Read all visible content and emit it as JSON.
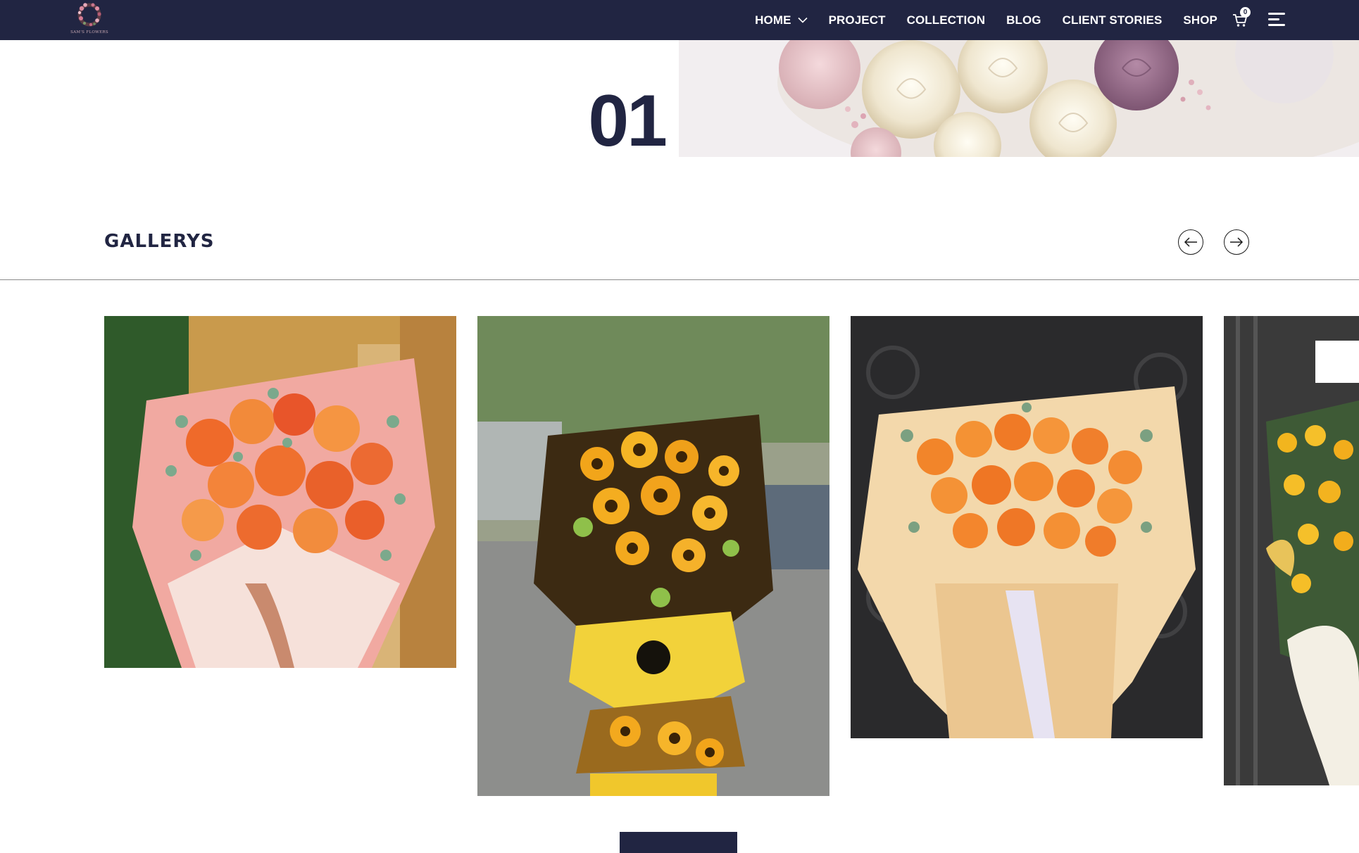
{
  "brand": {
    "logo_text": "SAM'S FLOWERS"
  },
  "nav": {
    "items": [
      {
        "label": "HOME"
      },
      {
        "label": "PROJECT"
      },
      {
        "label": "COLLECTION"
      },
      {
        "label": "BLOG"
      },
      {
        "label": "CLIENT STORIES"
      },
      {
        "label": "SHOP"
      }
    ],
    "cart_count": "0"
  },
  "hero": {
    "slide_number": "01"
  },
  "gallery": {
    "title": "GALLERYS",
    "items": [
      {
        "name": "orange roses bouquet with eucalyptus in pink wrapping"
      },
      {
        "name": "sunflower congratulation flower stand"
      },
      {
        "name": "orange roses bouquet in cream wrapping"
      },
      {
        "name": "yellow flower stand with white ribbon"
      }
    ]
  },
  "colors": {
    "navbar": "#212542",
    "accent": "#212542",
    "text": "#212542",
    "background": "#ffffff"
  },
  "icons": [
    "chevron-down-icon",
    "cart-icon",
    "menu-icon",
    "arrow-left-icon",
    "arrow-right-icon"
  ]
}
